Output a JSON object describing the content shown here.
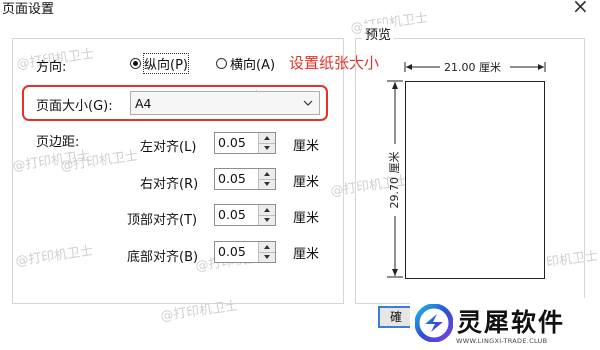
{
  "dialog": {
    "title": "页面设置",
    "close_glyph": "×"
  },
  "orientation": {
    "label": "方向:",
    "portrait_label": "纵向(P)",
    "landscape_label": "横向(A)",
    "selected": "portrait"
  },
  "annotation": {
    "text": "设置纸张大小",
    "color": "#e5332a"
  },
  "paper_size": {
    "label": "页面大小(G):",
    "value": "A4"
  },
  "margins": {
    "label": "页边距:",
    "unit": "厘米",
    "fields": [
      {
        "label": "左对齐(L)",
        "value": "0.05"
      },
      {
        "label": "右对齐(R)",
        "value": "0.05"
      },
      {
        "label": "顶部对齐(T)",
        "value": "0.05"
      },
      {
        "label": "底部对齐(B)",
        "value": "0.05"
      }
    ]
  },
  "preview": {
    "label": "预览",
    "width_text": "21.00 厘米",
    "height_text": "29.70 厘米"
  },
  "watermark": {
    "text": "@打印机卫士"
  },
  "footer_button": {
    "label": "確"
  },
  "branding": {
    "name": "灵犀软件",
    "url": "WWW.LINGXI-TRADE.CLUB",
    "colors": {
      "cyan": "#1fb7e0",
      "blue": "#2a4fd8",
      "purple": "#7a3fe0"
    }
  }
}
